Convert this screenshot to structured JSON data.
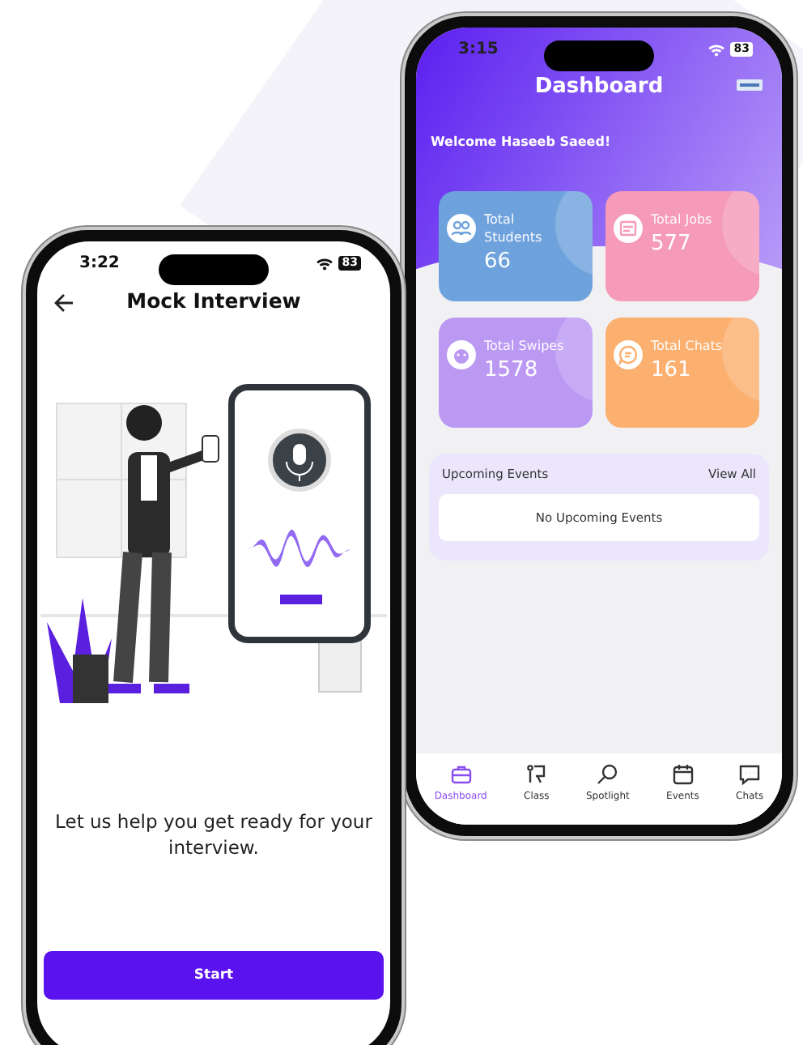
{
  "interview_phone": {
    "status_bar": {
      "time": "3:22",
      "battery": "83"
    },
    "title": "Mock Interview",
    "message": "Let us help you get ready for your interview.",
    "button": "Start"
  },
  "dashboard_phone": {
    "status_bar": {
      "time": "3:15",
      "battery": "83"
    },
    "title": "Dashboard",
    "welcome": "Welcome Haseeb Saeed!",
    "stats": [
      {
        "kind": "students",
        "label": "Total Students",
        "value": "66",
        "color": "#6ea2dc"
      },
      {
        "kind": "jobs",
        "label": "Total Jobs",
        "value": "577",
        "color": "#f59ab8"
      },
      {
        "kind": "swipes",
        "label": "Total Swipes",
        "value": "1578",
        "color": "#bb99f3"
      },
      {
        "kind": "chats",
        "label": "Total Chats",
        "value": "161",
        "color": "#fbb070"
      }
    ],
    "events": {
      "title": "Upcoming Events",
      "link": "View All",
      "empty": "No Upcoming Events"
    },
    "nav": [
      {
        "kind": "briefcase",
        "label": "Dashboard",
        "selected": true
      },
      {
        "kind": "easel",
        "label": "Class",
        "selected": false
      },
      {
        "kind": "magnifier",
        "label": "Spotlight",
        "selected": false
      },
      {
        "kind": "calendar",
        "label": "Events",
        "selected": false
      },
      {
        "kind": "chat",
        "label": "Chats",
        "selected": false
      }
    ]
  }
}
